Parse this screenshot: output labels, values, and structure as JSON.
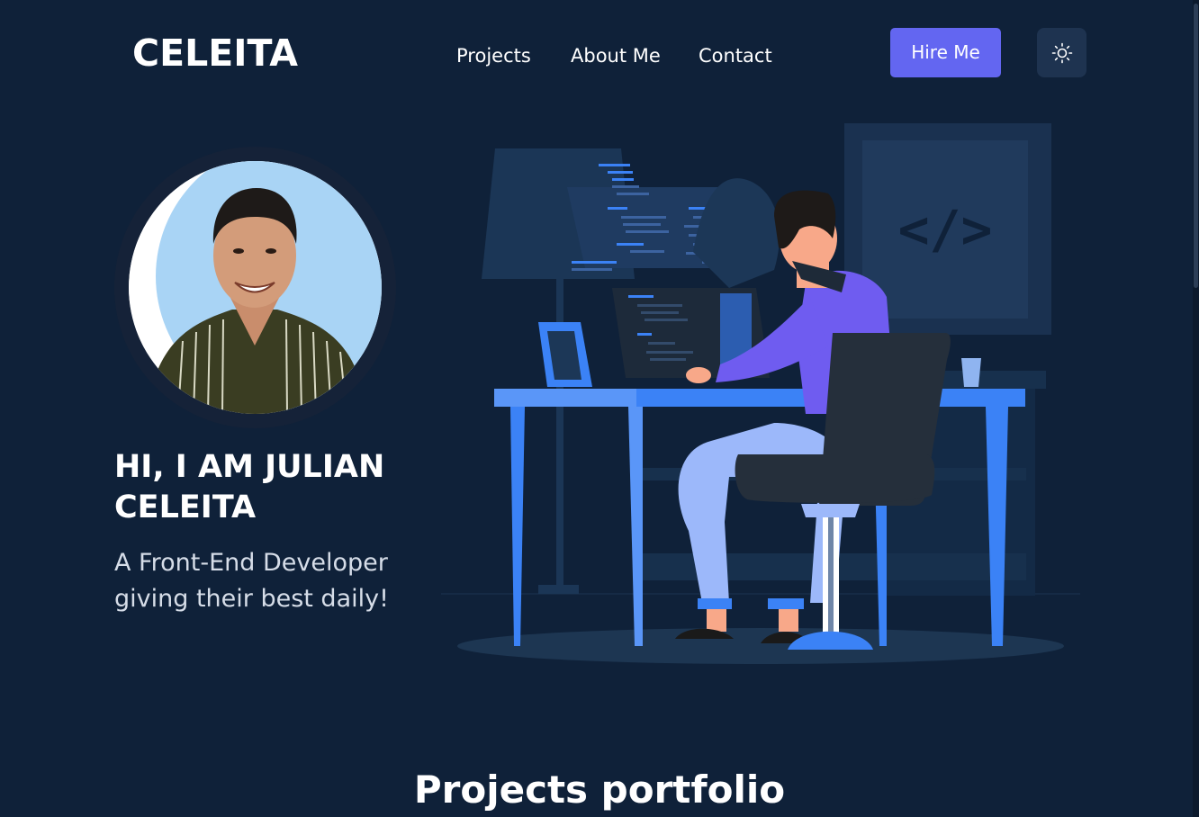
{
  "header": {
    "logo": "CELEITA",
    "nav": [
      {
        "label": "Projects"
      },
      {
        "label": "About Me"
      },
      {
        "label": "Contact"
      }
    ],
    "hire_label": "Hire Me",
    "theme_toggle_icon": "sun-icon"
  },
  "hero": {
    "title": "HI, I AM JULIAN CELEITA",
    "subtitle": "A Front-End Developer giving their best daily!",
    "code_symbol": "</>"
  },
  "projects": {
    "title": "Projects portfolio"
  },
  "colors": {
    "background": "#0f2139",
    "accent": "#6366f1",
    "desk": "#3b82f6"
  }
}
